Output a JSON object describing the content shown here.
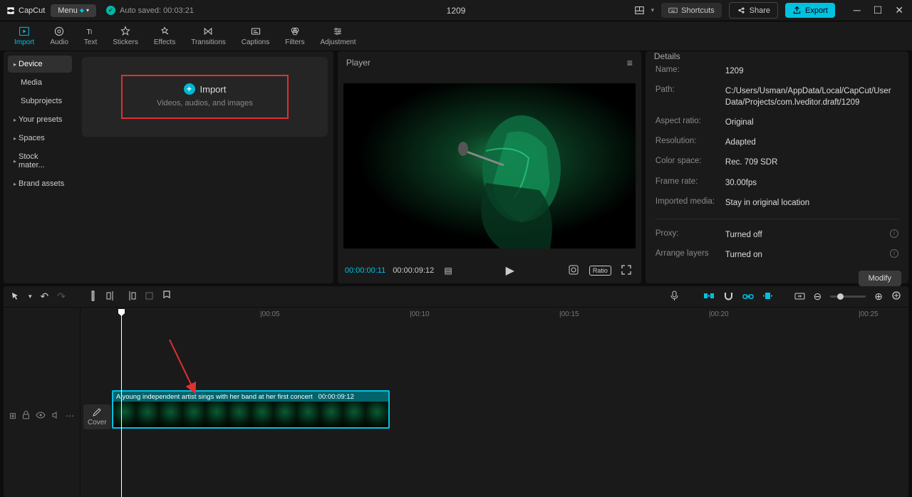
{
  "app": {
    "name": "CapCut"
  },
  "titlebar": {
    "menu_label": "Menu",
    "autosave_text": "Auto saved: 00:03:21",
    "project_title": "1209",
    "shortcuts_label": "Shortcuts",
    "share_label": "Share",
    "export_label": "Export"
  },
  "toolbar": {
    "tabs": [
      {
        "label": "Import",
        "icon": "import"
      },
      {
        "label": "Audio",
        "icon": "audio"
      },
      {
        "label": "Text",
        "icon": "text"
      },
      {
        "label": "Stickers",
        "icon": "stickers"
      },
      {
        "label": "Effects",
        "icon": "effects"
      },
      {
        "label": "Transitions",
        "icon": "transitions"
      },
      {
        "label": "Captions",
        "icon": "captions"
      },
      {
        "label": "Filters",
        "icon": "filters"
      },
      {
        "label": "Adjustment",
        "icon": "adjustment"
      }
    ],
    "active_index": 0
  },
  "left_panel": {
    "items": [
      {
        "label": "Device",
        "active": true,
        "expand": true
      },
      {
        "label": "Media",
        "indent": true
      },
      {
        "label": "Subprojects",
        "indent": true
      },
      {
        "label": "Your presets",
        "expand": true
      },
      {
        "label": "Spaces",
        "expand": true
      },
      {
        "label": "Stock mater...",
        "expand": true
      },
      {
        "label": "Brand assets",
        "expand": true
      }
    ],
    "import_title": "Import",
    "import_sub": "Videos, audios, and images"
  },
  "player": {
    "title": "Player",
    "current_time": "00:00:00:11",
    "duration": "00:00:09:12"
  },
  "details": {
    "title": "Details",
    "rows": [
      {
        "label": "Name:",
        "value": "1209"
      },
      {
        "label": "Path:",
        "value": "C:/Users/Usman/AppData/Local/CapCut/User Data/Projects/com.lveditor.draft/1209"
      },
      {
        "label": "Aspect ratio:",
        "value": "Original"
      },
      {
        "label": "Resolution:",
        "value": "Adapted"
      },
      {
        "label": "Color space:",
        "value": "Rec. 709 SDR"
      },
      {
        "label": "Frame rate:",
        "value": "30.00fps"
      },
      {
        "label": "Imported media:",
        "value": "Stay in original location"
      }
    ],
    "rows2": [
      {
        "label": "Proxy:",
        "value": "Turned off",
        "info": true
      },
      {
        "label": "Arrange layers",
        "value": "Turned on",
        "info": true
      }
    ],
    "modify_label": "Modify"
  },
  "timeline": {
    "ticks": [
      {
        "label": "|00:05",
        "pos": 252
      },
      {
        "label": "|00:10",
        "pos": 462
      },
      {
        "label": "|00:15",
        "pos": 672
      },
      {
        "label": "|00:20",
        "pos": 882
      },
      {
        "label": "|00:25",
        "pos": 1092
      }
    ],
    "cover_label": "Cover",
    "clip_title": "A young independent artist sings with her band at her first concert",
    "clip_duration": "00:00:09:12"
  }
}
